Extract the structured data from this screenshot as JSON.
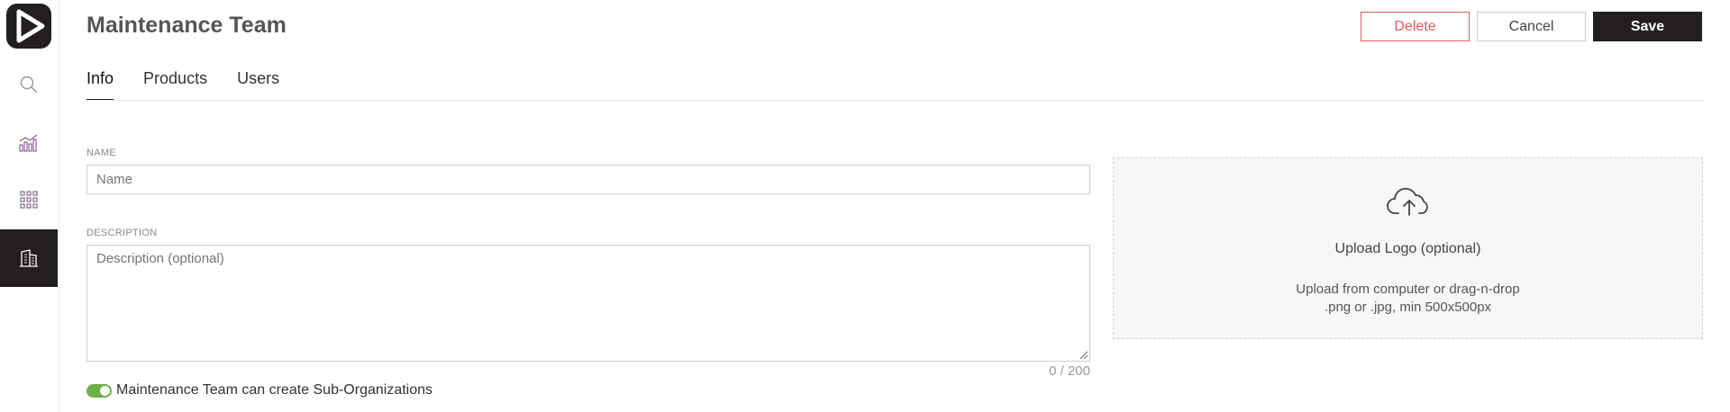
{
  "header": {
    "title": "Maintenance Team",
    "delete_label": "Delete",
    "cancel_label": "Cancel",
    "save_label": "Save"
  },
  "sidebar": {
    "items": [
      {
        "icon": "search-icon"
      },
      {
        "icon": "chart-icon"
      },
      {
        "icon": "grid-apps-icon"
      },
      {
        "icon": "building-icon",
        "active": true
      }
    ]
  },
  "tabs": [
    {
      "label": "Info",
      "active": true
    },
    {
      "label": "Products"
    },
    {
      "label": "Users"
    }
  ],
  "form": {
    "name_label": "NAME",
    "name_placeholder": "Name",
    "name_value": "",
    "description_label": "DESCRIPTION",
    "description_placeholder": "Description (optional)",
    "description_value": "",
    "counter": "0 / 200",
    "toggle_label": "Maintenance Team can create Sub-Organizations",
    "toggle_on": true
  },
  "upload": {
    "title": "Upload Logo (optional)",
    "hint_line1": "Upload from computer or drag-n-drop",
    "hint_line2": ".png or .jpg, min 500x500px"
  },
  "colors": {
    "accent_dark": "#231f20",
    "delete_red": "#e25b5b",
    "toggle_green": "#6fb04a",
    "sidebar_icon_purple": "#7a5a8c"
  }
}
